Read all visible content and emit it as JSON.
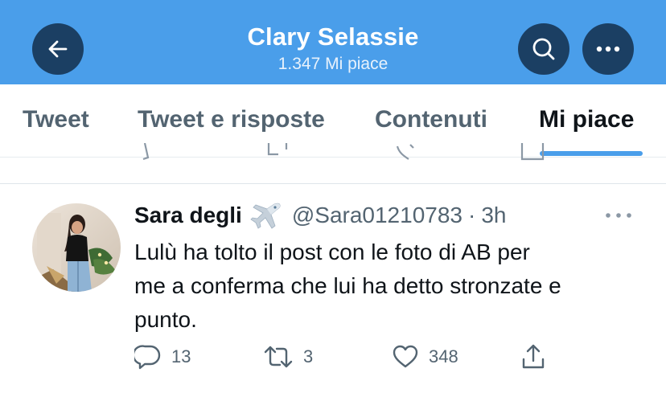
{
  "header": {
    "title": "Clary Selassie",
    "subtitle": "1.347 Mi piace",
    "back_icon": "arrow-left-icon",
    "search_icon": "search-icon",
    "more_icon": "more-icon"
  },
  "tabs": [
    {
      "label": "Tweet",
      "active": false
    },
    {
      "label": "Tweet e risposte",
      "active": false
    },
    {
      "label": "Contenuti",
      "active": false
    },
    {
      "label": "Mi piace",
      "active": true
    }
  ],
  "tweet": {
    "author_name": "Sara degli",
    "author_emoji": "airplane-icon",
    "handle": "@Sara01210783",
    "separator": "·",
    "time": "3h",
    "text": "Lulù ha tolto il post con le foto di AB per\nme a  conferma che lui ha detto stronzate e\npunto.",
    "reply_count": "13",
    "retweet_count": "3",
    "like_count": "348"
  },
  "colors": {
    "header_bg": "#4a9eea",
    "header_button_bg": "#1b3f63",
    "accent": "#4a9eea",
    "text_primary": "#0f1419",
    "text_secondary": "#536471"
  }
}
